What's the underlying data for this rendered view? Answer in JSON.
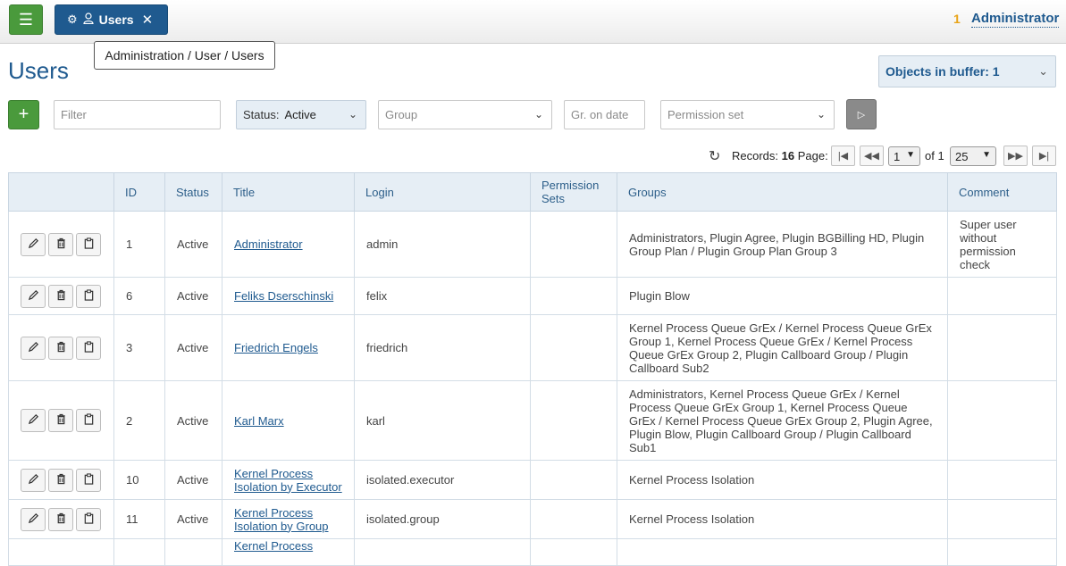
{
  "header": {
    "tab_label": "Users",
    "user_count": "1",
    "user_name": "Administrator"
  },
  "breadcrumb": "Administration / User / Users",
  "page_title": "Users",
  "buffer": {
    "label": "Objects in buffer: 1"
  },
  "filters": {
    "filter_placeholder": "Filter",
    "status_label": "Status:",
    "status_value": "Active",
    "group_placeholder": "Group",
    "gr_on_date_placeholder": "Gr. on date",
    "permission_set_placeholder": "Permission set"
  },
  "pager": {
    "records_label": "Records:",
    "records_count": "16",
    "page_label": "Page:",
    "current_page": "1",
    "of_text": "of 1",
    "page_size": "25"
  },
  "table": {
    "columns": [
      "",
      "ID",
      "Status",
      "Title",
      "Login",
      "Permission Sets",
      "Groups",
      "Comment"
    ],
    "rows": [
      {
        "id": "1",
        "status": "Active",
        "title": "Administrator",
        "login": "admin",
        "permsets": "",
        "groups": "Administrators, Plugin Agree, Plugin BGBilling HD, Plugin Group Plan / Plugin Group Plan Group 3",
        "comment": "Super user without permission check"
      },
      {
        "id": "6",
        "status": "Active",
        "title": "Feliks Dserschinski",
        "login": "felix",
        "permsets": "",
        "groups": "Plugin Blow",
        "comment": ""
      },
      {
        "id": "3",
        "status": "Active",
        "title": "Friedrich Engels",
        "login": "friedrich",
        "permsets": "",
        "groups": "Kernel Process Queue GrEx / Kernel Process Queue GrEx Group 1, Kernel Process Queue GrEx / Kernel Process Queue GrEx Group 2, Plugin Callboard Group / Plugin Callboard Sub2",
        "comment": ""
      },
      {
        "id": "2",
        "status": "Active",
        "title": "Karl Marx",
        "login": "karl",
        "permsets": "",
        "groups": "Administrators, Kernel Process Queue GrEx / Kernel Process Queue GrEx Group 1, Kernel Process Queue GrEx / Kernel Process Queue GrEx Group 2, Plugin Agree, Plugin Blow, Plugin Callboard Group / Plugin Callboard Sub1",
        "comment": ""
      },
      {
        "id": "10",
        "status": "Active",
        "title": "Kernel Process Isolation by Executor",
        "login": "isolated.executor",
        "permsets": "",
        "groups": "Kernel Process Isolation",
        "comment": ""
      },
      {
        "id": "11",
        "status": "Active",
        "title": "Kernel Process Isolation by Group",
        "login": "isolated.group",
        "permsets": "",
        "groups": "Kernel Process Isolation",
        "comment": ""
      },
      {
        "id": "",
        "status": "",
        "title": "Kernel Process",
        "login": "",
        "permsets": "",
        "groups": "",
        "comment": ""
      }
    ]
  },
  "icons": {
    "menu": "hamburger-icon",
    "tab_settings": "gear-icon",
    "tab_user": "user-icon",
    "tab_close": "close-icon",
    "add": "plus-icon",
    "run": "play-icon",
    "refresh": "refresh-icon",
    "edit": "pencil-icon",
    "delete": "trash-icon",
    "copy": "clipboard-icon"
  },
  "colors": {
    "brand_blue": "#1f5a8f",
    "green": "#4a9a3c",
    "header_bg": "#e6eef5",
    "accent_orange": "#e8a317"
  }
}
